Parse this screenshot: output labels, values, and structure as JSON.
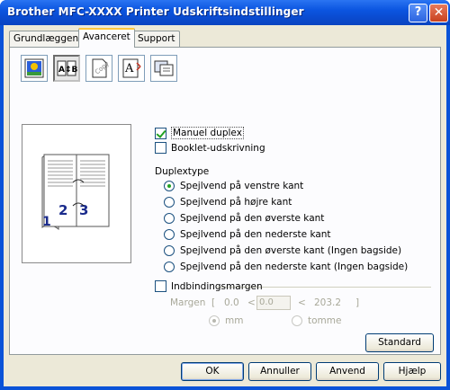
{
  "window": {
    "title": "Brother MFC-XXXX Printer Udskriftsindstillinger",
    "help_label": "?",
    "close_label": "✕"
  },
  "tabs": [
    {
      "label": "Grundlæggende",
      "active": false
    },
    {
      "label": "Avanceret",
      "active": true
    },
    {
      "label": "Support",
      "active": false
    }
  ],
  "toolbar_icons": [
    "color-icon",
    "duplex-icon",
    "watermark-icon",
    "page-setting-icon",
    "device-options-icon"
  ],
  "toolbar_text": {
    "ab": "A↕B",
    "copy": "Copy",
    "a": "A"
  },
  "options": {
    "manual_duplex": {
      "label": "Manuel duplex",
      "checked": true
    },
    "booklet": {
      "label": "Booklet-udskrivning",
      "checked": false
    }
  },
  "duplex": {
    "heading": "Duplextype",
    "choices": [
      {
        "label": "Spejlvend på venstre kant",
        "selected": true
      },
      {
        "label": "Spejlvend på højre kant",
        "selected": false
      },
      {
        "label": "Spejlvend på den øverste kant",
        "selected": false
      },
      {
        "label": "Spejlvend på den nederste kant",
        "selected": false
      },
      {
        "label": "Spejlvend på den øverste kant (Ingen bagside)",
        "selected": false
      },
      {
        "label": "Spejlvend på den nederste kant (Ingen bagside)",
        "selected": false
      }
    ]
  },
  "binding": {
    "label": "Indbindingsmargen",
    "checked": false,
    "margin_label": "Margen",
    "range_open": "[",
    "range_min": "0.0",
    "lt1": "<",
    "value": "0.0",
    "lt2": "<",
    "range_max": "203.2",
    "range_close": "]",
    "unit_mm": "mm",
    "unit_inch": "tomme",
    "selected_unit": "mm"
  },
  "preview": {
    "page_left": "1",
    "page_mid": "2",
    "page_right": "3"
  },
  "buttons": {
    "standard": "Standard",
    "ok": "OK",
    "cancel": "Annuller",
    "apply": "Anvend",
    "help": "Hjælp"
  }
}
